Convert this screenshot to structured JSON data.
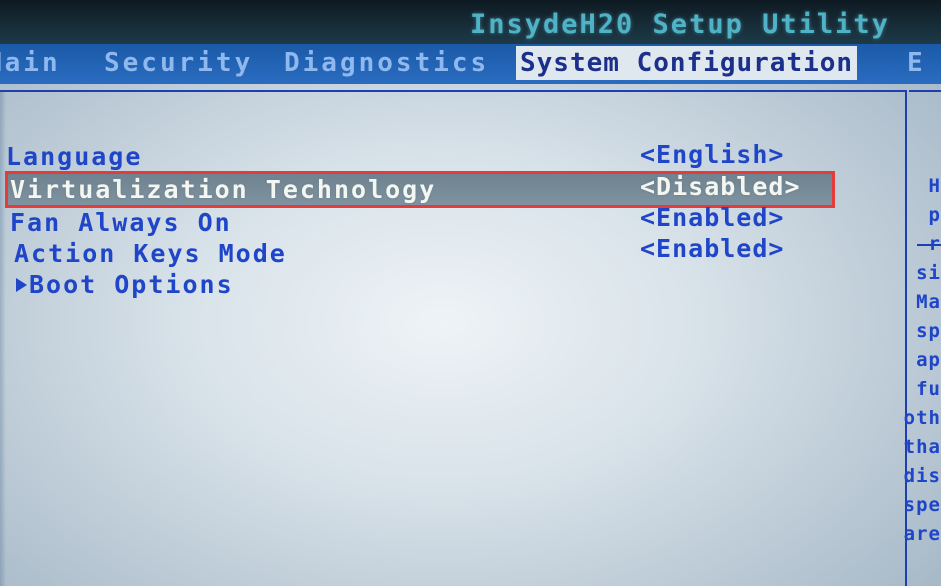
{
  "app": {
    "title": "InsydeH20 Setup Utility"
  },
  "menu": {
    "items": [
      {
        "label": "Main",
        "active": false
      },
      {
        "label": "Security",
        "active": false
      },
      {
        "label": "Diagnostics",
        "active": false
      },
      {
        "label": "System Configuration",
        "active": true
      },
      {
        "label": "E",
        "active": false
      }
    ]
  },
  "settings": {
    "language": {
      "label": "Language",
      "value": "<English>"
    },
    "virtualization": {
      "label": "Virtualization Technology",
      "value": "<Disabled>"
    },
    "fan": {
      "label": "Fan Always On",
      "value": "<Enabled>"
    },
    "action_keys": {
      "label": "Action Keys Mode",
      "value": "<Enabled>"
    },
    "boot_options": {
      "label": "Boot Options"
    }
  },
  "help": {
    "lines": [
      "H",
      "p",
      "r",
      "si",
      "Ma",
      "sp",
      "ap",
      "fu",
      "oth",
      "tha",
      "dis",
      "spe",
      "are"
    ]
  },
  "colors": {
    "menu_bg": "#2a6cc0",
    "label_blue": "#1f45c8",
    "highlight_red": "#e53b3b",
    "title_cyan": "#4fb3c7"
  }
}
